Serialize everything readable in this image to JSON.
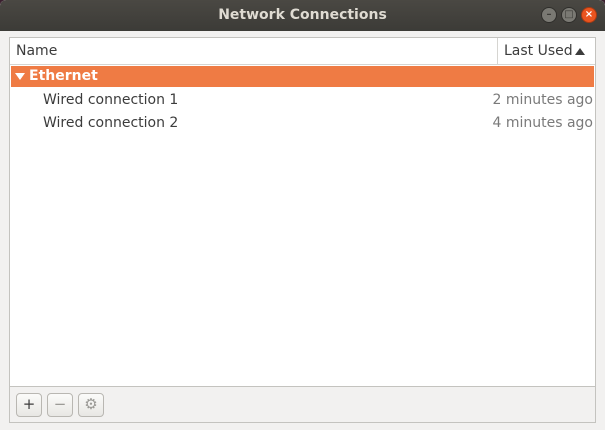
{
  "window": {
    "title": "Network Connections",
    "buttons": {
      "minimize": "–",
      "maximize": "□",
      "close": "×"
    }
  },
  "columns": {
    "name": "Name",
    "last_used": "Last Used"
  },
  "groups": [
    {
      "label": "Ethernet",
      "connections": [
        {
          "name": "Wired connection 1",
          "last_used": "2 minutes ago"
        },
        {
          "name": "Wired connection 2",
          "last_used": "4 minutes ago"
        }
      ]
    }
  ],
  "toolbar": {
    "add": "+",
    "remove": "−",
    "settings": "⚙"
  },
  "colors": {
    "accent": "#ef7b44",
    "titlebar": "#3c3b37",
    "close": "#e9541f"
  }
}
